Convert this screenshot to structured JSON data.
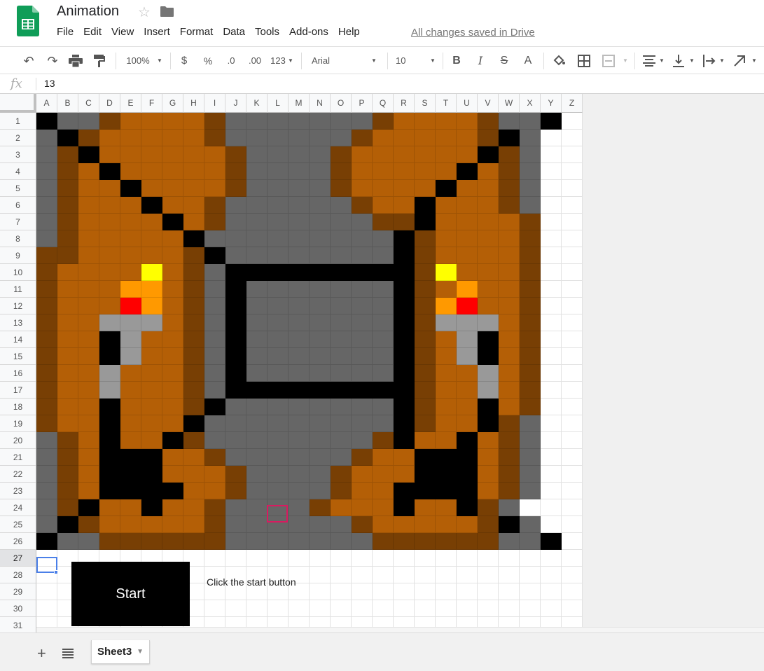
{
  "header": {
    "title": "Animation",
    "menu": [
      "File",
      "Edit",
      "View",
      "Insert",
      "Format",
      "Data",
      "Tools",
      "Add-ons",
      "Help"
    ],
    "saved_status": "All changes saved in Drive"
  },
  "toolbar": {
    "zoom": "100%",
    "currency": "$",
    "percent": "%",
    "dec_decrease": ".0",
    "dec_increase": ".00",
    "more_formats": "123",
    "font": "Arial",
    "font_size": "10",
    "bold": "B",
    "italic": "I",
    "strike": "S",
    "text_color": "A"
  },
  "formula_bar": {
    "label": "fx",
    "value": "13"
  },
  "columns": [
    "A",
    "B",
    "C",
    "D",
    "E",
    "F",
    "G",
    "H",
    "I",
    "J",
    "K",
    "L",
    "M",
    "N",
    "O",
    "P",
    "Q",
    "R",
    "S",
    "T",
    "U",
    "V",
    "W",
    "X",
    "Y",
    "Z"
  ],
  "rows": [
    "1",
    "2",
    "3",
    "4",
    "5",
    "6",
    "7",
    "8",
    "9",
    "10",
    "11",
    "12",
    "13",
    "14",
    "15",
    "16",
    "17",
    "18",
    "19",
    "20",
    "21",
    "22",
    "23",
    "24",
    "25",
    "26",
    "27",
    "28",
    "29",
    "30",
    "31"
  ],
  "active_row": 27,
  "palette": {
    "K": "#000000",
    "G": "#666666",
    "O": "#b45f06",
    "D": "#783f04",
    "Y": "#ffff00",
    "F": "#ff9900",
    "R": "#ff0000",
    "L": "#999999",
    "W": "#ffffff"
  },
  "pixel_rows": [
    "KGGDOOOODGGGGGGGDOOOODGGK",
    "GKDOOOOODGGGGGGDOOOOODKG",
    "GDKOOOOOODGGGGDOOOOOOKDG",
    "GDOKOOOOODGGGGDOOOOOKODG",
    "GDOOKOOOODGGGGDOOOOKOODG",
    "GDOOOKOODGGGGGGDOOKOOODG",
    "GDOOOOKODGGGGGGGDDKOOOOD",
    "GDOOOOOKGGGGGGGGGKDOOOOD",
    "DDOOOOODKGGGGGGGGKDOOOOD",
    "DOOOOYODGKKKKKKKKKDYOOOD",
    "DOOOFFODGKGGGGGGGKDOFOOD",
    "DOOORFODGKGGGGGGGKDFROOD",
    "DOOLLLODGKGGGGGGGKDLLLOD",
    "DOOKLOODGKGGGGGGGKDOLKOD",
    "DOOKLOODGKGGGGGGGKDOLKOD",
    "DOOLOOODGKGGGGGGGKDOOLOD",
    "DOOLOOODGKKKKKKKKKDOOLOD",
    "DOOKOOODKGGGGGGGGKDOOKOD",
    "DOOKOOOKGGGGGGGGGKDOOKDG",
    "GDOKOOKDGGGGGGGGDKOOKODG",
    "GDOKKKOODGGGGGGDOOKKKODG",
    "GDOKKKOOODGGGGDOOOKKKODG",
    "GDOKKKKOODGGGGDOOKKKKODG",
    "GDKOOKOODGGGGDOOOKOOKDG",
    "GKDOOOOODGGGGGGDOOOOODKG",
    "KGGDDDDDDGGGGGGGDDDDDDGGK"
  ],
  "start_button": "Start",
  "hint_text": "Click the start button",
  "sheet_tab": "Sheet3"
}
